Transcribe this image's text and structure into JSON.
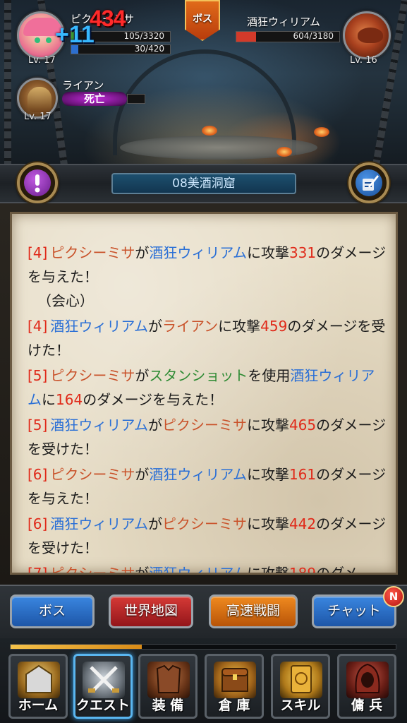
{
  "header": {
    "boss_tab": "ボス",
    "player": {
      "name": "ピクシーミサ",
      "level": "Lv. 17",
      "hp": "105/3320",
      "mp": "30/420"
    },
    "ally": {
      "name": "ライアン",
      "level": "Lv. 17",
      "status": "死亡"
    },
    "enemy": {
      "name": "酒狂ウィリアム",
      "level": "Lv. 16",
      "hp": "604/3180"
    },
    "damage_popup": "434",
    "heal_popup": "+11"
  },
  "location": {
    "name": "08美酒洞窟"
  },
  "log": [
    {
      "turn": "[4]",
      "actor": "ピクシーミサ",
      "particle1": "が",
      "target": "酒狂ウィリアム",
      "particle2": "に攻撃",
      "damage": "331",
      "rest": "のダメージを与えた！",
      "extra": "（会心）"
    },
    {
      "turn": "[4]",
      "actor": "酒狂ウィリアム",
      "particle1": "が",
      "target": "ライアン",
      "particle2": "に攻撃",
      "damage": "459",
      "rest": "のダメージを受けた！"
    },
    {
      "turn": "[5]",
      "actor": "ピクシーミサ",
      "particle1": "が",
      "skill": "スタンショット",
      "particle_skill": "を使用",
      "target": "酒狂ウィリアム",
      "particle2": "に",
      "damage": "164",
      "rest": "のダメージを与えた！"
    },
    {
      "turn": "[5]",
      "actor": "酒狂ウィリアム",
      "particle1": "が",
      "target": "ピクシーミサ",
      "particle2": "に攻撃",
      "damage": "465",
      "rest": "のダメージを受けた！"
    },
    {
      "turn": "[6]",
      "actor": "ピクシーミサ",
      "particle1": "が",
      "target": "酒狂ウィリアム",
      "particle2": "に攻撃",
      "damage": "161",
      "rest": "のダメージを与えた！"
    },
    {
      "turn": "[6]",
      "actor": "酒狂ウィリアム",
      "particle1": "が",
      "target": "ピクシーミサ",
      "particle2": "に攻撃",
      "damage": "442",
      "rest": "のダメージを受けた！"
    },
    {
      "turn": "[7]",
      "actor": "ピクシーミサ",
      "particle1": "が",
      "target": "酒狂ウィリアム",
      "particle2": "に攻撃",
      "damage": "189",
      "rest": "のダメ"
    }
  ],
  "commands": {
    "boss": "ボス",
    "world_map": "世界地図",
    "fast_battle": "高速戦闘",
    "chat": "チャット",
    "chat_badge": "N"
  },
  "progress": {
    "fraction": 0.34
  },
  "nav": [
    {
      "label": "ホーム"
    },
    {
      "label": "クエスト"
    },
    {
      "label": "装 備"
    },
    {
      "label": "倉 庫"
    },
    {
      "label": "スキル"
    },
    {
      "label": "傭 兵"
    }
  ],
  "colors": {
    "turn": "#e02a1a",
    "player_name": "#c9522a",
    "enemy_name": "#2a6fd6",
    "skill_name": "#2f8b34",
    "damage": "#e02a1a",
    "hp_fill": "#3c9a33",
    "enemy_hp_fill": "#d23a2a"
  },
  "icons": {
    "quest_alert": "exclamation-icon",
    "memo": "quill-memo-icon"
  }
}
